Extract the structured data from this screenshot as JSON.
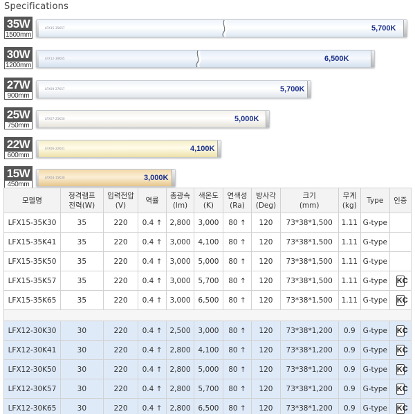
{
  "heading": "Specifications",
  "lamps": [
    {
      "watt": "35W",
      "length": "1500mm",
      "kelvin": "5,700K",
      "mini": "LFX15-35K57"
    },
    {
      "watt": "30W",
      "length": "1200mm",
      "kelvin": "6,500K",
      "mini": "LFX12-30K65"
    },
    {
      "watt": "27W",
      "length": "900mm",
      "kelvin": "5,700K",
      "mini": "LFX09-27K57"
    },
    {
      "watt": "25W",
      "length": "750mm",
      "kelvin": "5,000K",
      "mini": "LFX07-25K50"
    },
    {
      "watt": "22W",
      "length": "600mm",
      "kelvin": "4,100K",
      "mini": "LFX06-22K41"
    },
    {
      "watt": "15W",
      "length": "450mm",
      "kelvin": "3,000K",
      "mini": "LFX04-15K30"
    }
  ],
  "table": {
    "headers": [
      [
        "모델명"
      ],
      [
        "정격램프",
        "전력(W)"
      ],
      [
        "입력전압",
        "(V)"
      ],
      [
        "역률"
      ],
      [
        "총광속",
        "(lm)"
      ],
      [
        "색온도",
        "(K)"
      ],
      [
        "연색성",
        "(Ra)"
      ],
      [
        "방사각",
        "(Deg)"
      ],
      [
        "크기",
        "(mm)"
      ],
      [
        "무게",
        "(kg)"
      ],
      [
        "Type"
      ],
      [
        "인증"
      ]
    ],
    "groupA": [
      {
        "model": "LFX15-35K30",
        "watt": "35",
        "volt": "220",
        "pf": "0.4 ↑",
        "lm": "2,800",
        "k": "3,000",
        "ra": "80 ↑",
        "deg": "120",
        "size": "73*38*1,500",
        "kg": "1.11",
        "type": "G-type",
        "cert": ""
      },
      {
        "model": "LFX15-35K41",
        "watt": "35",
        "volt": "220",
        "pf": "0.4 ↑",
        "lm": "3,000",
        "k": "4,100",
        "ra": "80 ↑",
        "deg": "120",
        "size": "73*38*1,500",
        "kg": "1.11",
        "type": "G-type",
        "cert": ""
      },
      {
        "model": "LFX15-35K50",
        "watt": "35",
        "volt": "220",
        "pf": "0.4 ↑",
        "lm": "3,000",
        "k": "5,000",
        "ra": "80 ↑",
        "deg": "120",
        "size": "73*38*1,500",
        "kg": "1.11",
        "type": "G-type",
        "cert": ""
      },
      {
        "model": "LFX15-35K57",
        "watt": "35",
        "volt": "220",
        "pf": "0.4 ↑",
        "lm": "3,000",
        "k": "5,700",
        "ra": "80 ↑",
        "deg": "120",
        "size": "73*38*1,500",
        "kg": "1.11",
        "type": "G-type",
        "cert": "KC"
      },
      {
        "model": "LFX15-35K65",
        "watt": "35",
        "volt": "220",
        "pf": "0.4 ↑",
        "lm": "3,000",
        "k": "6,500",
        "ra": "80 ↑",
        "deg": "120",
        "size": "73*38*1,500",
        "kg": "1.11",
        "type": "G-type",
        "cert": "KC"
      }
    ],
    "groupB": [
      {
        "model": "LFX12-30K30",
        "watt": "30",
        "volt": "220",
        "pf": "0.4 ↑",
        "lm": "2,500",
        "k": "3,000",
        "ra": "80 ↑",
        "deg": "120",
        "size": "73*38*1,200",
        "kg": "0.9",
        "type": "G-type",
        "cert": "KC"
      },
      {
        "model": "LFX12-30K41",
        "watt": "30",
        "volt": "220",
        "pf": "0.4 ↑",
        "lm": "2,800",
        "k": "4,100",
        "ra": "80 ↑",
        "deg": "120",
        "size": "73*38*1,200",
        "kg": "0.9",
        "type": "G-type",
        "cert": "KC"
      },
      {
        "model": "LFX12-30K50",
        "watt": "30",
        "volt": "220",
        "pf": "0.4 ↑",
        "lm": "2,800",
        "k": "5,000",
        "ra": "80 ↑",
        "deg": "120",
        "size": "73*38*1,200",
        "kg": "0.9",
        "type": "G-type",
        "cert": "KC"
      },
      {
        "model": "LFX12-30K57",
        "watt": "30",
        "volt": "220",
        "pf": "0.4 ↑",
        "lm": "2,800",
        "k": "5,700",
        "ra": "80 ↑",
        "deg": "120",
        "size": "73*38*1,200",
        "kg": "0.9",
        "type": "G-type",
        "cert": "KC"
      },
      {
        "model": "LFX12-30K65",
        "watt": "30",
        "volt": "220",
        "pf": "0.4 ↑",
        "lm": "2,800",
        "k": "6,500",
        "ra": "80 ↑",
        "deg": "120",
        "size": "73*38*1,200",
        "kg": "0.9",
        "type": "G-type",
        "cert": "KC"
      }
    ]
  },
  "colors": {
    "kelvin_text": "#1a2f8a",
    "highlight_row": "#dfeaf8",
    "watt_label_bg": "#555555"
  }
}
